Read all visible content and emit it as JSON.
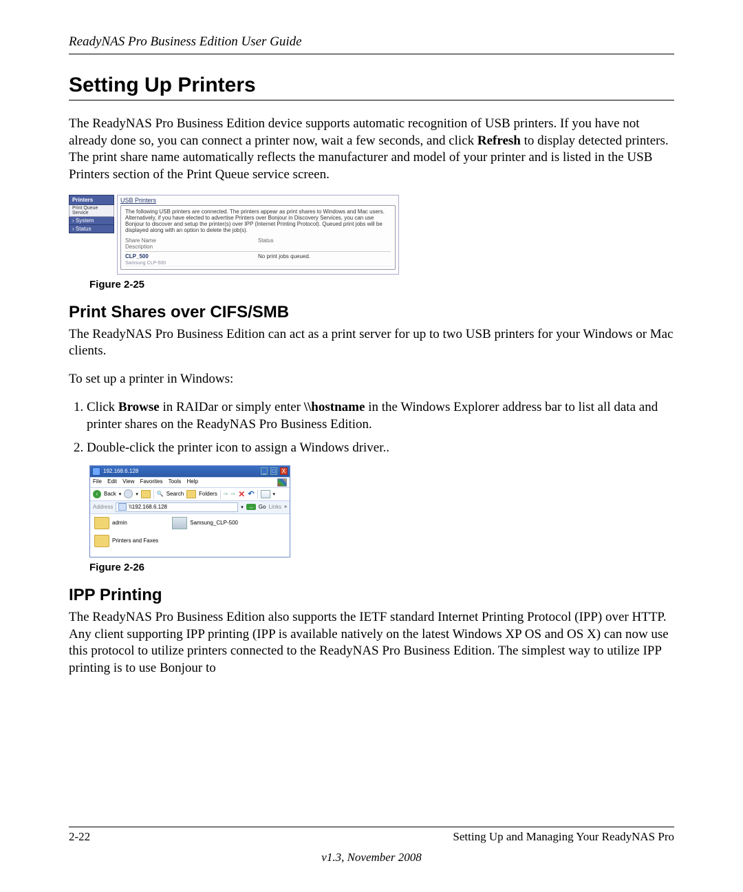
{
  "header": {
    "guide_title": "ReadyNAS Pro Business Edition User Guide"
  },
  "section": {
    "title": "Setting Up Printers",
    "intro_pre": "The ReadyNAS Pro Business Edition device supports automatic recognition of USB printers. If you have not already done so, you can connect a printer now, wait a few seconds, and click ",
    "intro_bold": "Refresh",
    "intro_post": " to display detected printers. The print share name automatically reflects the manufacturer and model of your printer and is listed in the USB Printers section of the Print Queue service screen."
  },
  "fig25": {
    "nav": {
      "printers": "Printers",
      "print_queue": "Print Queue Service",
      "system": "System",
      "status": "Status"
    },
    "panel": {
      "title": "USB Printers",
      "desc": "The following USB printers are connected. The printers appear as print shares to Windows and Mac users. Alternatively, if you have elected to advertise Printers over Bonjour in Discovery Services, you can use Bonjour to discover and setup the printer(s) over IPP (Internet Printing Protocol). Queued print jobs will be displayed along with an option to delete the job(s).",
      "col1a": "Share Name",
      "col1b": "Description",
      "col2": "Status",
      "row_share": "CLP_500",
      "row_desc": "Samsung CLP-500",
      "row_status": "No print jobs queued."
    },
    "caption": "Figure 2-25"
  },
  "sub1": {
    "title": "Print Shares over CIFS/SMB",
    "p1": "The ReadyNAS Pro Business Edition can act as a print server for up to two USB printers for your Windows or Mac clients.",
    "p2": "To set up a printer in Windows:",
    "step1_pre": "Click ",
    "step1_b1": "Browse",
    "step1_mid": " in RAIDar or simply enter ",
    "step1_b2": "\\\\hostname",
    "step1_post": " in the Windows Explorer address bar to list all data and printer shares on the ReadyNAS Pro Business Edition.",
    "step2": "Double-click the printer icon to assign a Windows driver.."
  },
  "fig26": {
    "title": "192.168.6.128",
    "menus": {
      "file": "File",
      "edit": "Edit",
      "view": "View",
      "favorites": "Favorites",
      "tools": "Tools",
      "help": "Help"
    },
    "toolbar": {
      "back": "Back",
      "search": "Search",
      "folders": "Folders"
    },
    "addr_label": "Address",
    "addr_value": "\\\\192.168.6.128",
    "go": "Go",
    "links": "Links",
    "items": {
      "admin": "admin",
      "pf": "Printers and Faxes",
      "printer": "Samsung_CLP-500"
    },
    "caption": "Figure 2-26"
  },
  "sub2": {
    "title": "IPP Printing",
    "p1": "The ReadyNAS Pro Business Edition also supports the IETF standard Internet Printing Protocol (IPP) over HTTP. Any client supporting IPP printing (IPP is available natively on the latest Windows XP OS and OS X) can now use this protocol to utilize printers connected to the ReadyNAS Pro Business Edition. The simplest way to utilize IPP printing is to use Bonjour to"
  },
  "footer": {
    "page": "2-22",
    "chapter": "Setting Up and Managing Your ReadyNAS Pro",
    "version": "v1.3, November 2008"
  }
}
